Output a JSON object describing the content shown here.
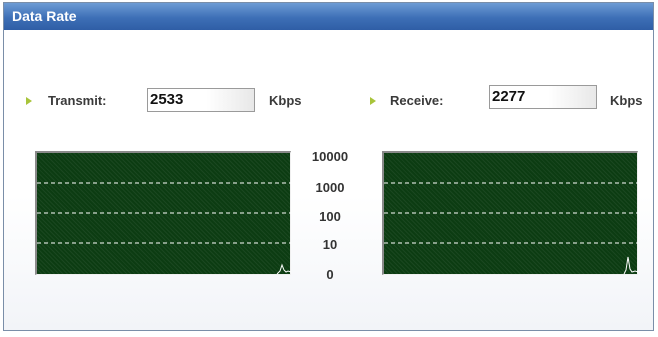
{
  "window": {
    "title": "Data Rate"
  },
  "transmit": {
    "label": "Transmit:",
    "value": "2533",
    "unit": "Kbps"
  },
  "receive": {
    "label": "Receive:",
    "value": "2277",
    "unit": "Kbps"
  },
  "scale": {
    "labels": [
      "10000",
      "1000",
      "100",
      "10",
      "0"
    ]
  },
  "colors": {
    "graph_background": "#0c3c12",
    "gridline": "#ffffff",
    "trace": "#ffffff",
    "bullet": "#a8c43a",
    "titlebar": "#3d6fb6"
  }
}
